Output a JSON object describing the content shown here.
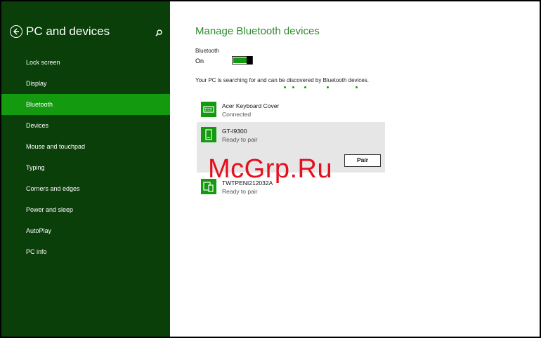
{
  "sidebar": {
    "title": "PC and devices",
    "back_icon": "back-arrow-icon",
    "search_icon": "search-icon",
    "items": [
      {
        "label": "Lock screen"
      },
      {
        "label": "Display"
      },
      {
        "label": "Bluetooth",
        "selected": true
      },
      {
        "label": "Devices"
      },
      {
        "label": "Mouse and touchpad"
      },
      {
        "label": "Typing"
      },
      {
        "label": "Corners and edges"
      },
      {
        "label": "Power and sleep"
      },
      {
        "label": "AutoPlay"
      },
      {
        "label": "PC info"
      }
    ]
  },
  "main": {
    "title": "Manage Bluetooth devices",
    "bluetooth_label": "Bluetooth",
    "bluetooth_state": "On",
    "search_message": "Your PC is searching for and can be discovered by Bluetooth devices.",
    "devices": [
      {
        "name": "Acer Keyboard Cover",
        "status": "Connected",
        "icon": "keyboard-icon"
      },
      {
        "name": "GT-I9300",
        "status": "Ready to pair",
        "icon": "phone-icon",
        "action": "Pair"
      },
      {
        "name": "TWTPENI212032A",
        "status": "Ready to pair",
        "icon": "pc-phone-icon"
      }
    ]
  },
  "watermark": "McGrp.Ru",
  "colors": {
    "sidebar_bg": "#0a3f0a",
    "accent": "#139a0f",
    "title_green": "#2e8b2e",
    "watermark_red": "#e4101e"
  }
}
